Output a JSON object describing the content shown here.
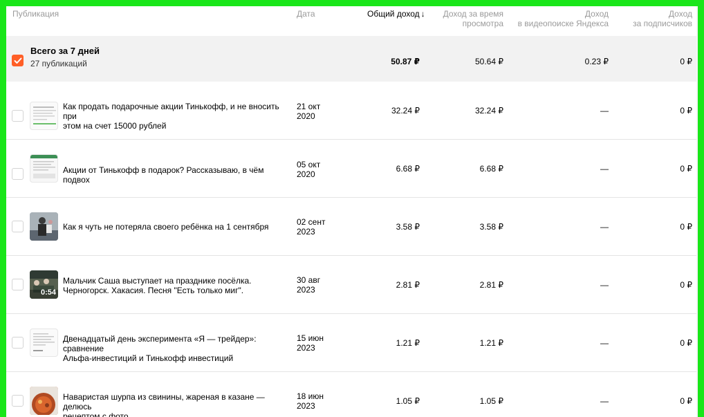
{
  "columns": {
    "publication": "Публикация",
    "date": "Дата",
    "total_income": "Общий доход",
    "sort_arrow": "↓",
    "watch_income_l1": "Доход за время",
    "watch_income_l2": "просмотра",
    "videosearch_l1": "Доход",
    "videosearch_l2": "в видеопоиске Яндекса",
    "subscribers_l1": "Доход",
    "subscribers_l2": "за подписчиков"
  },
  "total": {
    "title": "Всего за 7 дней",
    "subtitle": "27 публикаций",
    "total_income": "50.87 ₽",
    "watch_income": "50.64 ₽",
    "videosearch_income": "0.23 ₽",
    "subscribers_income": "0 ₽"
  },
  "rows": [
    {
      "title_l1": "Как продать подарочные акции Тинькофф, и не вносить при",
      "title_l2": "этом на счет 15000 рублей",
      "date_l1": "21 окт",
      "date_l2": "2020",
      "total_income": "32.24 ₽",
      "watch_income": "32.24 ₽",
      "videosearch_income": "—",
      "subscribers_income": "0 ₽",
      "thumb": "document-thumbnail"
    },
    {
      "title_l1": "Акции от Тинькофф в подарок? Рассказываю, в чём подвох",
      "title_l2": "",
      "date_l1": "05 окт",
      "date_l2": "2020",
      "total_income": "6.68 ₽",
      "watch_income": "6.68 ₽",
      "videosearch_income": "—",
      "subscribers_income": "0 ₽",
      "thumb": "document-green-thumbnail"
    },
    {
      "title_l1": "Как я чуть не потеряла своего ребёнка на 1 сентября",
      "title_l2": "",
      "date_l1": "02 сент",
      "date_l2": "2023",
      "total_income": "3.58 ₽",
      "watch_income": "3.58 ₽",
      "videosearch_income": "—",
      "subscribers_income": "0 ₽",
      "thumb": "photo-thumbnail"
    },
    {
      "title_l1": "Мальчик Саша выступает на празднике посёлка.",
      "title_l2": "Черногорск. Хакасия. Песня \"Есть только миг\".",
      "date_l1": "30 авг",
      "date_l2": "2023",
      "total_income": "2.81 ₽",
      "watch_income": "2.81 ₽",
      "videosearch_income": "—",
      "subscribers_income": "0 ₽",
      "thumb": "video-thumbnail",
      "duration": "0:54"
    },
    {
      "title_l1": "Двенадцатый день эксперимента «Я — трейдер»: сравнение",
      "title_l2": "Альфа-инвестиций и Тинькофф инвестиций",
      "date_l1": "15 июн",
      "date_l2": "2023",
      "total_income": "1.21 ₽",
      "watch_income": "1.21 ₽",
      "videosearch_income": "—",
      "subscribers_income": "0 ₽",
      "thumb": "document-thumbnail"
    },
    {
      "title_l1": "Наваристая шурпа из свинины, жареная в казане — делюсь",
      "title_l2": "рецептом с фото",
      "date_l1": "18 июн",
      "date_l2": "2023",
      "total_income": "1.05 ₽",
      "watch_income": "1.05 ₽",
      "videosearch_income": "—",
      "subscribers_income": "0 ₽",
      "thumb": "food-thumbnail"
    }
  ],
  "colors": {
    "accent": "#ff5f27",
    "frame": "#19e619",
    "total_bg": "#f2f2f2"
  }
}
